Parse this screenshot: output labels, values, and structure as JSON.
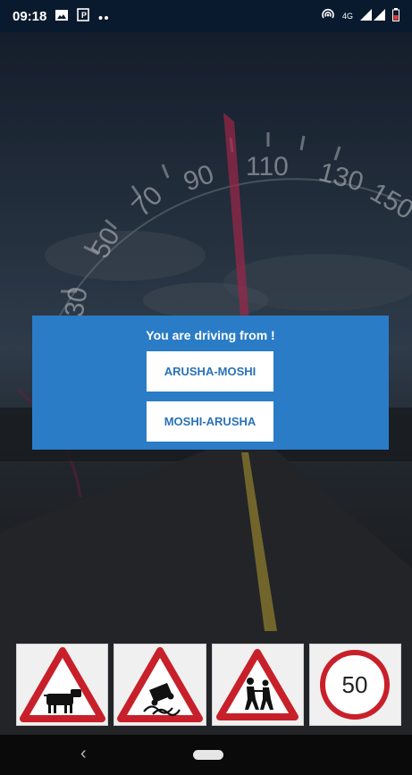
{
  "status_bar": {
    "time": "09:18",
    "network": "4G",
    "icons": [
      "image-icon",
      "parking-icon",
      "more-dots-icon",
      "hotspot-icon",
      "signal-icon",
      "battery-icon"
    ]
  },
  "dialog": {
    "title": "You are driving from !",
    "options": [
      {
        "label": "ARUSHA-MOSHI"
      },
      {
        "label": "MOSHI-ARUSHA"
      }
    ]
  },
  "speedometer_labels": [
    "30",
    "50",
    "70",
    "90",
    "110",
    "130",
    "150"
  ],
  "signs": [
    {
      "icon": "cattle-warning-sign"
    },
    {
      "icon": "slippery-road-sign"
    },
    {
      "icon": "children-crossing-sign"
    },
    {
      "icon": "speed-limit-sign",
      "value": "50"
    }
  ],
  "nav_bar": {
    "back_symbol": "‹"
  },
  "colors": {
    "dialog_bg": "#2a7cc7",
    "button_text": "#2a72b8",
    "sign_red": "#c8202a",
    "status_bg": "#0a1a2e"
  }
}
